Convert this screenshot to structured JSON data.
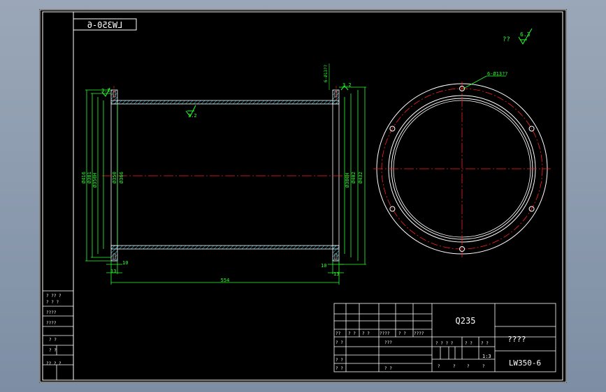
{
  "drawing": {
    "top_code": "LW350-6",
    "roughness_note": "??",
    "roughness_value": "6.3"
  },
  "colors": {
    "background": "#000000",
    "border": "#ffffff",
    "dimension": "#28ff2e",
    "centerline": "#ff2020",
    "hatch": "#28e0ff"
  },
  "section_view": {
    "roughness_left": "3.2",
    "roughness_right": "3.2",
    "roughness_mid": "3.2",
    "hole_callout_small": "6-Ø13??",
    "left_diameters": [
      "Ø416",
      "Ø381",
      "Ø350H",
      "Ø350",
      "Ø366"
    ],
    "right_diameters": [
      "Ø380H",
      "Ø402",
      "Ø432"
    ],
    "flange_thickness_left": "10",
    "flange_thickness_right": "10",
    "offset_left": "13",
    "offset_right": "13",
    "overall_length": "554"
  },
  "flange_view": {
    "hole_callout": "6-Ø13??"
  },
  "side_table": {
    "rows": [
      "? ?? ?",
      "? ? ?",
      "????",
      "????",
      "?  ?",
      "?  ?",
      "??  ? ?"
    ]
  },
  "title_block": {
    "material": "Q235",
    "name": "????",
    "code": "LW350-6",
    "scale": "1:3",
    "row_labels": [
      "??",
      "? ?",
      "? ?",
      "????",
      "? ?",
      "????"
    ],
    "sign_labels": [
      "? ?",
      "? ?",
      "???",
      "? ?",
      "? ?"
    ],
    "stage_label": "? ? ? ?",
    "weight_label": "? ?",
    "scale_label": "? ?",
    "sheet_labels": [
      "?",
      "?",
      "?",
      "?"
    ]
  }
}
